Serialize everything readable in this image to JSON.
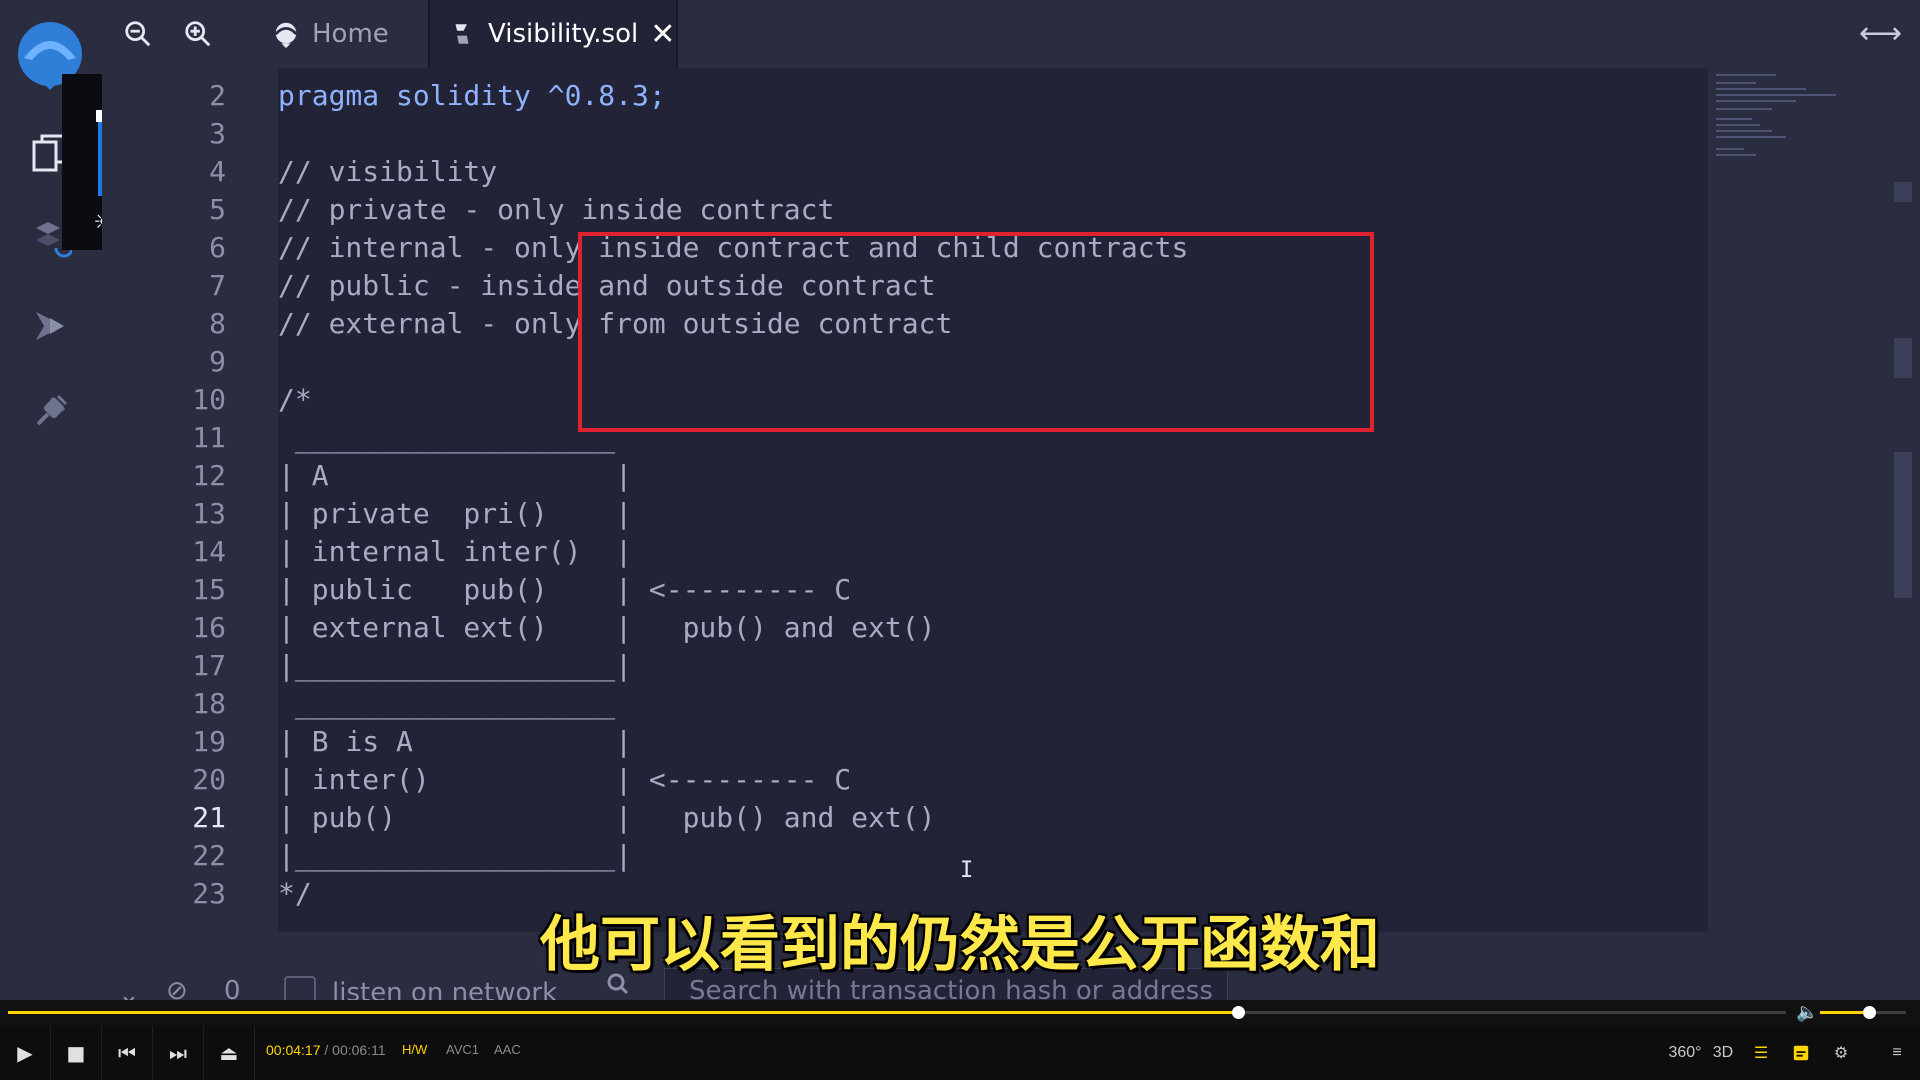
{
  "topbar": {
    "tabs": [
      {
        "label": "Home",
        "icon": "remix-logo-icon"
      },
      {
        "label": "Visibility.sol",
        "icon": "file-sync-icon",
        "active": true
      }
    ],
    "close_glyph": "✕",
    "expand_glyph": "⟷"
  },
  "brightness": {
    "level": 0.85,
    "icon": "sun-icon"
  },
  "editor": {
    "active_line": "21",
    "lines": [
      {
        "n": "2",
        "text": "pragma solidity ^0.8.3;"
      },
      {
        "n": "3",
        "text": ""
      },
      {
        "n": "4",
        "text": "// visibility"
      },
      {
        "n": "5",
        "text": "// private - only inside contract"
      },
      {
        "n": "6",
        "text": "// internal - only inside contract and child contracts"
      },
      {
        "n": "7",
        "text": "// public - inside and outside contract"
      },
      {
        "n": "8",
        "text": "// external - only from outside contract"
      },
      {
        "n": "9",
        "text": ""
      },
      {
        "n": "10",
        "text": "/*"
      },
      {
        "n": "11",
        "text": " ___________________"
      },
      {
        "n": "12",
        "text": "| A                 |"
      },
      {
        "n": "13",
        "text": "| private  pri()    |"
      },
      {
        "n": "14",
        "text": "| internal inter()  |"
      },
      {
        "n": "15",
        "text": "| public   pub()    | <--------- C"
      },
      {
        "n": "16",
        "text": "| external ext()    |   pub() and ext()"
      },
      {
        "n": "17",
        "text": "|___________________|"
      },
      {
        "n": "18",
        "text": " ___________________"
      },
      {
        "n": "19",
        "text": "| B is A            |"
      },
      {
        "n": "20",
        "text": "| inter()           | <--------- C"
      },
      {
        "n": "21",
        "text": "| pub()             |   pub() and ext()"
      },
      {
        "n": "22",
        "text": "|___________________|"
      },
      {
        "n": "23",
        "text": "*/"
      }
    ]
  },
  "terminal": {
    "collapse_icon": "double-chevron-down-icon",
    "clear_icon": "ban-icon",
    "pending_count": "0",
    "listen_label": "listen on network",
    "search_placeholder": "Search with transaction hash or address"
  },
  "subtitle": "他可以看到的仍然是公开函数和",
  "player": {
    "current_time": "00:04:17",
    "separator": "/",
    "duration": "00:06:11",
    "progress": 0.692,
    "volume": 0.57,
    "badges": [
      "H/W",
      "AVC1",
      "AAC"
    ],
    "badge_colors": [
      "#ffd400",
      "#8a8a8a",
      "#8a8a8a"
    ],
    "right_controls": [
      "360°",
      "3D"
    ]
  },
  "colors": {
    "editor_bg": "#222336",
    "panel_bg": "#2a2c3f",
    "highlight_box": "#e0222f",
    "subtitle": "#ffe84a",
    "accent": "#ffd400"
  }
}
